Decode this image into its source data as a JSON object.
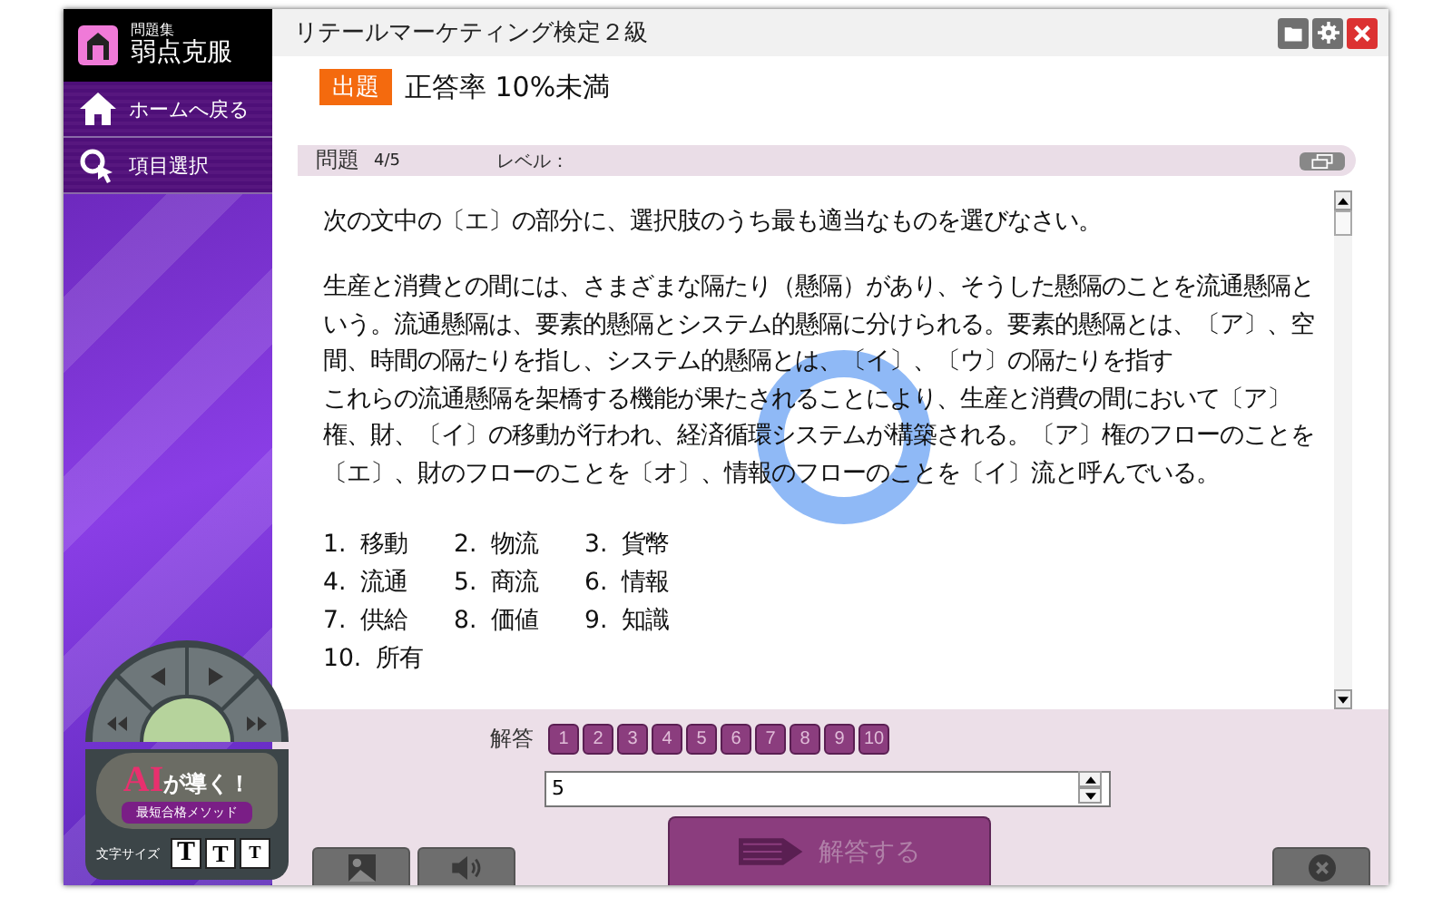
{
  "sidebar": {
    "logo_caption": "問題集",
    "logo_title": "弱点克服",
    "items": [
      {
        "label": "ホームへ戻る",
        "kind": "home"
      },
      {
        "label": "項目選択",
        "kind": "select"
      }
    ],
    "ai_panel": {
      "headline_main": "AI",
      "headline_rest": "が導く！",
      "subtitle": "最短合格メソッド",
      "font_size_label": "文字サイズ",
      "font_sizes": [
        "T",
        "T",
        "T"
      ]
    }
  },
  "window": {
    "title": "リテールマーケティング検定２級"
  },
  "filter": {
    "badge": "出題",
    "text": "正答率 10%未満"
  },
  "question_bar": {
    "label": "問題",
    "number": "4/5",
    "level_label": "レベル："
  },
  "question": {
    "instruction": "次の文中の〔エ〕の部分に、選択肢のうち最も適当なものを選びなさい。",
    "passage": [
      "生産と消費との間には、さまざまな隔たり（懸隔）があり、そうした懸隔のことを流通懸隔と",
      "いう。流通懸隔は、要素的懸隔とシステム的懸隔に分けられる。要素的懸隔とは、〔ア〕、空",
      "間、時間の隔たりを指し、システム的懸隔とは、〔イ〕、〔ウ〕の隔たりを指す",
      "これらの流通懸隔を架橋する機能が果たされることにより、生産と消費の間において〔ア〕",
      "権、財、〔イ〕の移動が行われ、経済循環システムが構築される。〔ア〕権のフローのことを",
      "〔エ〕、財のフローのことを〔オ〕、情報のフローのことを〔イ〕流と呼んでいる。"
    ],
    "choices": [
      {
        "number": "1.",
        "text": "移動"
      },
      {
        "number": "2.",
        "text": "物流"
      },
      {
        "number": "3.",
        "text": "貨幣"
      },
      {
        "number": "4.",
        "text": "流通"
      },
      {
        "number": "5.",
        "text": "商流"
      },
      {
        "number": "6.",
        "text": "情報"
      },
      {
        "number": "7.",
        "text": "供給"
      },
      {
        "number": "8.",
        "text": "価値"
      },
      {
        "number": "9.",
        "text": "知識"
      },
      {
        "number": "10.",
        "text": "所有"
      }
    ]
  },
  "answer": {
    "label": "解答",
    "options": [
      "1",
      "2",
      "3",
      "4",
      "5",
      "6",
      "7",
      "8",
      "9",
      "10"
    ],
    "value": "5",
    "submit": "解答する"
  }
}
